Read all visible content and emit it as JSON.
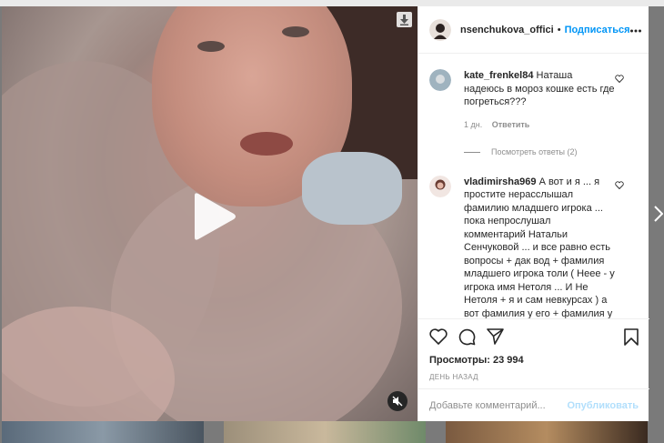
{
  "post": {
    "username": "nsenchukova_offici",
    "separator": "•",
    "follow_label": "Подписаться"
  },
  "comments": [
    {
      "username": "kate_frenkel84",
      "text": "Наташа надеюсь в мороз кошке есть где погреться???",
      "time": "1 дн.",
      "reply_label": "Ответить",
      "view_replies": "Посмотреть ответы (2)"
    },
    {
      "username": "vladimirsha969",
      "text": "А вот и я ... я простите нерасслышал фамилию младшего игрока ... пока непрослушал комментарий Натальи Сенчуковой ... и все равно есть вопросы + дак вод + фамилия младшего игрока толи ( Неее - у игрока имя Нетоля ... И Не Нетоля + я и сам невкурсах ) а вот фамилия у его + фамилия у его слишком известная чтобы я"
    }
  ],
  "stats": {
    "views": "Просмотры: 23 994",
    "date": "ДЕНЬ НАЗАД"
  },
  "composer": {
    "placeholder": "Добавьте комментарий...",
    "publish_label": "Опубликовать"
  },
  "icons": {
    "play": "play-icon",
    "download": "download-icon",
    "mute": "muted-speaker-icon",
    "more": "more-horizontal-icon",
    "heart": "heart-icon",
    "comment": "comment-icon",
    "share": "paper-plane-icon",
    "bookmark": "bookmark-icon",
    "next": "chevron-right-icon"
  },
  "colors": {
    "link": "#0095f6",
    "publish_disabled": "#b2dffc",
    "text": "#262626",
    "secondary": "#8e8e8e"
  }
}
